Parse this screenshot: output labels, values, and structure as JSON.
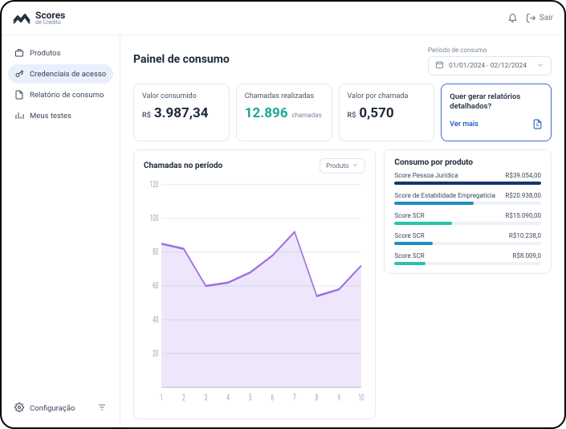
{
  "brand": {
    "main": "Scores",
    "sub": "de Crédito"
  },
  "top": {
    "logout": "Sair"
  },
  "sidebar": {
    "items": [
      {
        "label": "Produtos"
      },
      {
        "label": "Credenciais de acesso"
      },
      {
        "label": "Relatório de consumo"
      },
      {
        "label": "Meus testes"
      }
    ],
    "settings": "Configuração"
  },
  "header": {
    "title": "Painel de consumo",
    "period_label": "Período de consumo",
    "period_value": "01/01/2024 - 02/12/2024"
  },
  "metrics": {
    "m1": {
      "title": "Valor consumido",
      "prefix": "R$",
      "value": "3.987,34"
    },
    "m2": {
      "title": "Chamadas realizadas",
      "value": "12.896",
      "suffix": "chamadas"
    },
    "m3": {
      "title": "Valor por chamada",
      "prefix": "R$",
      "value": "0,570"
    }
  },
  "cta": {
    "title": "Quer gerar relatórios detalhados?",
    "link": "Ver mais"
  },
  "chart_panel": {
    "title": "Chamadas no período",
    "select_label": "Produto"
  },
  "chart_data": {
    "type": "area",
    "categories": [
      "1",
      "2",
      "3",
      "4",
      "5",
      "6",
      "7",
      "8",
      "9",
      "10"
    ],
    "values": [
      85,
      82,
      60,
      62,
      68,
      78,
      92,
      54,
      58,
      72
    ],
    "ylim": [
      0,
      120
    ],
    "yticks": [
      20,
      40,
      60,
      80,
      100,
      120
    ],
    "title": "Chamadas no período",
    "xlabel": "",
    "ylabel": ""
  },
  "consumo": {
    "title": "Consumo por produto",
    "items": [
      {
        "name": "Score Pessoa Jurídica",
        "value": "R$39.054,00",
        "pct": 100,
        "color": "#10386b"
      },
      {
        "name": "Score de Estabilidade Empregatícia",
        "value": "R$20.938,00",
        "pct": 54,
        "color": "#1f8fbf"
      },
      {
        "name": "Score SCR",
        "value": "R$15.090,00",
        "pct": 39,
        "color": "#29c2b1"
      },
      {
        "name": "Score SCR",
        "value": "R$10.238,0",
        "pct": 26,
        "color": "#1f8fbf"
      },
      {
        "name": "Score SCR",
        "value": "R$8.009,0",
        "pct": 21,
        "color": "#29c2b1"
      }
    ]
  }
}
